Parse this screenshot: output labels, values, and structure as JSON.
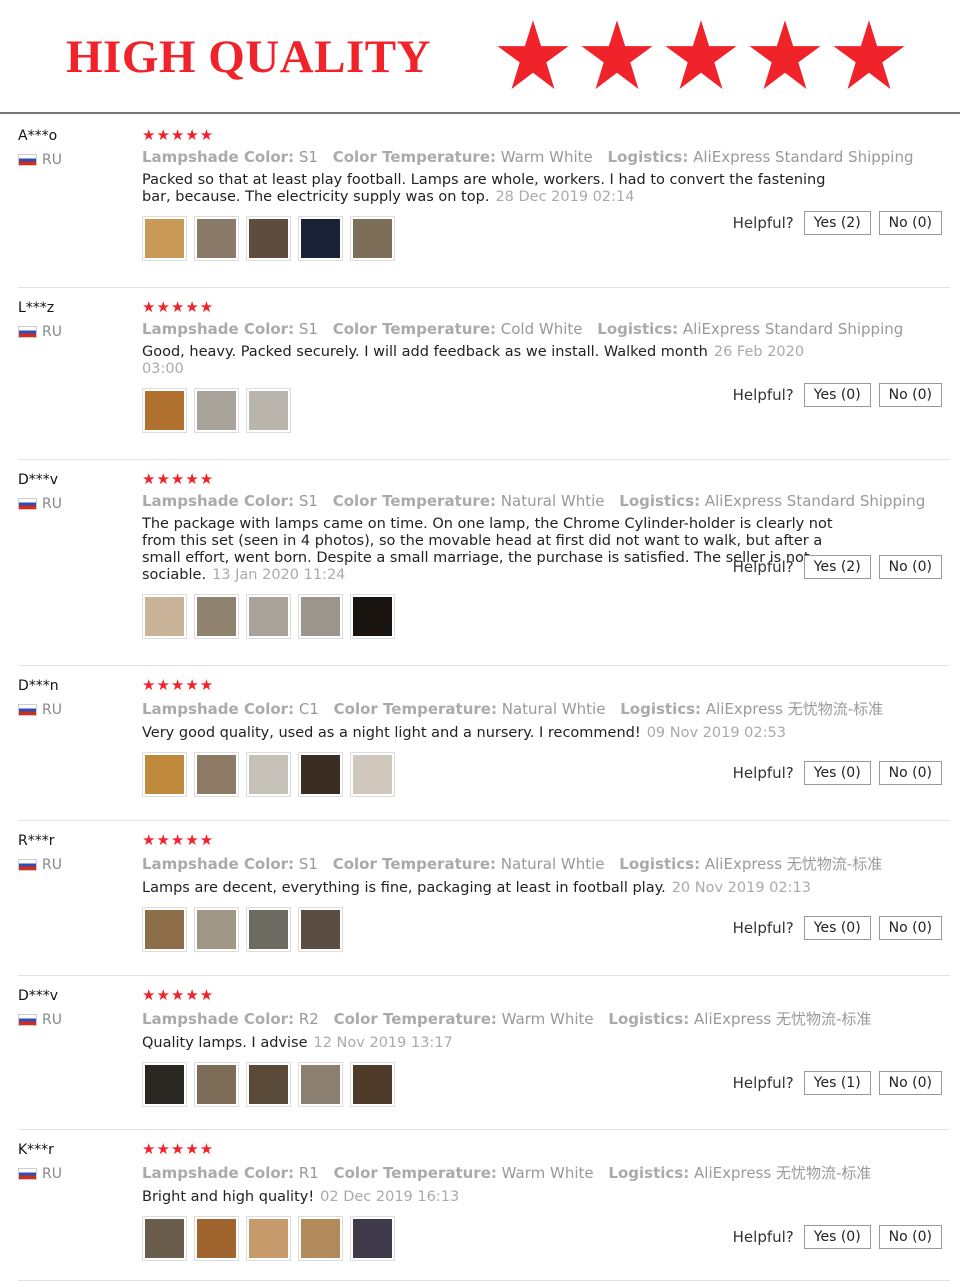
{
  "banner": {
    "title": "HIGH QUALITY",
    "star_count": 5,
    "star_color": "#f0232b"
  },
  "labels": {
    "lampshade": "Lampshade Color:",
    "temperature": "Color Temperature:",
    "logistics": "Logistics:",
    "helpful": "Helpful?"
  },
  "reviews": [
    {
      "user": "A***o",
      "country": "RU",
      "stars": "★★★★★",
      "lampshade": "S1",
      "temperature": "Warm White",
      "logistics": "AliExpress Standard Shipping",
      "text": "Packed so that at least play football. Lamps are whole, workers. I had to convert the fastening bar, because. The electricity supply was on top.",
      "date": "28 Dec 2019 02:14",
      "yes": "Yes (2)",
      "no": "No (0)",
      "photos": [
        "#c89a55",
        "#8a7a6a",
        "#5e4d3e",
        "#1c2236",
        "#7d6e5a"
      ]
    },
    {
      "user": "L***z",
      "country": "RU",
      "stars": "★★★★★",
      "lampshade": "S1",
      "temperature": "Cold White",
      "logistics": "AliExpress Standard Shipping",
      "text": "Good, heavy. Packed securely. I will add feedback as we install. Walked month",
      "date": "26 Feb 2020 03:00",
      "yes": "Yes (0)",
      "no": "No (0)",
      "photos": [
        "#b0722e",
        "#a8a29a",
        "#b9b5ad"
      ]
    },
    {
      "user": "D***v",
      "country": "RU",
      "stars": "★★★★★",
      "lampshade": "S1",
      "temperature": "Natural Whtie",
      "logistics": "AliExpress Standard Shipping",
      "text": "The package with lamps came on time. On one lamp, the Chrome Cylinder-holder is clearly not from this set (seen in 4 photos), so the movable head at first did not want to walk, but after a small effort, went born. Despite a small marriage, the purchase is satisfied. The seller is not sociable.",
      "date": "13 Jan 2020 11:24",
      "yes": "Yes (2)",
      "no": "No (0)",
      "photos": [
        "#c9b49a",
        "#8f8370",
        "#a8a298",
        "#9b958c",
        "#1a1410"
      ]
    },
    {
      "user": "D***n",
      "country": "RU",
      "stars": "★★★★★",
      "lampshade": "C1",
      "temperature": "Natural Whtie",
      "logistics": "AliExpress 无忧物流-标准",
      "text": "Very good quality, used as a night light and a nursery. I recommend!",
      "date": "09 Nov 2019 02:53",
      "yes": "Yes (0)",
      "no": "No (0)",
      "photos": [
        "#c08a3c",
        "#8e7b66",
        "#c5c0b8",
        "#3a2e22",
        "#d1c8bd"
      ]
    },
    {
      "user": "R***r",
      "country": "RU",
      "stars": "★★★★★",
      "lampshade": "S1",
      "temperature": "Natural Whtie",
      "logistics": "AliExpress 无忧物流-标准",
      "text": "Lamps are decent, everything is fine, packaging at least in football play.",
      "date": "20 Nov 2019 02:13",
      "yes": "Yes (0)",
      "no": "No (0)",
      "photos": [
        "#8e6d4a",
        "#a19786",
        "#6d6a61",
        "#5b4d42"
      ]
    },
    {
      "user": "D***v",
      "country": "RU",
      "stars": "★★★★★",
      "lampshade": "R2",
      "temperature": "Warm White",
      "logistics": "AliExpress 无忧物流-标准",
      "text": "Quality lamps. I advise",
      "date": "12 Nov 2019 13:17",
      "yes": "Yes (1)",
      "no": "No (0)",
      "photos": [
        "#2a2622",
        "#7c6c58",
        "#5a4a3a",
        "#8a7f70",
        "#4e3b2a"
      ]
    },
    {
      "user": "K***r",
      "country": "RU",
      "stars": "★★★★★",
      "lampshade": "R1",
      "temperature": "Warm White",
      "logistics": "AliExpress 无忧物流-标准",
      "text": "Bright and high quality!",
      "date": "02 Dec 2019 16:13",
      "yes": "Yes (0)",
      "no": "No (0)",
      "photos": [
        "#6b5d4c",
        "#a0652f",
        "#c79a6b",
        "#b28a5c",
        "#3f3a4a"
      ]
    }
  ]
}
